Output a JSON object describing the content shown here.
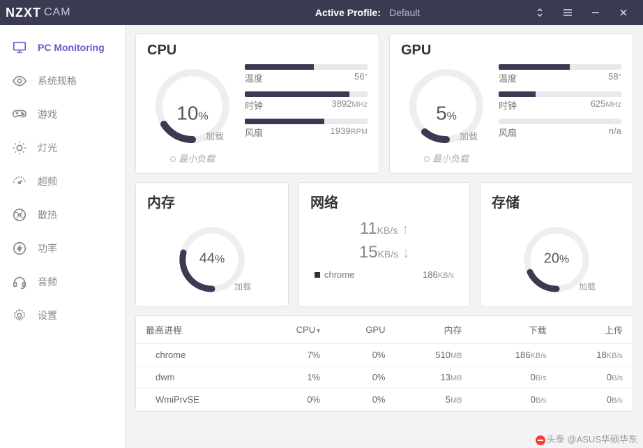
{
  "titlebar": {
    "brand": "NZXT",
    "brand_sub": "CAM",
    "profile_label": "Active Profile:",
    "profile_value": "Default"
  },
  "sidebar": [
    {
      "icon": "monitor",
      "label": "PC Monitoring",
      "active": true
    },
    {
      "icon": "eye",
      "label": "系统规格"
    },
    {
      "icon": "gamepad",
      "label": "游戏"
    },
    {
      "icon": "sun",
      "label": "灯光"
    },
    {
      "icon": "gauge",
      "label": "超频"
    },
    {
      "icon": "fan",
      "label": "散热"
    },
    {
      "icon": "power",
      "label": "功率"
    },
    {
      "icon": "headset",
      "label": "音频"
    },
    {
      "icon": "gear",
      "label": "设置"
    }
  ],
  "cpu": {
    "title": "CPU",
    "load_percent": 10,
    "load_label": "加载",
    "min_load_label": "最小负载",
    "stats": [
      {
        "label": "温度",
        "value": "56",
        "unit": "°",
        "fill": 56
      },
      {
        "label": "时钟",
        "value": "3892",
        "unit": "MHz",
        "fill": 85
      },
      {
        "label": "风扇",
        "value": "1939",
        "unit": "RPM",
        "fill": 65
      }
    ]
  },
  "gpu": {
    "title": "GPU",
    "load_percent": 5,
    "load_label": "加载",
    "min_load_label": "最小负载",
    "stats": [
      {
        "label": "温度",
        "value": "58",
        "unit": "°",
        "fill": 58
      },
      {
        "label": "时钟",
        "value": "625",
        "unit": "MHz",
        "fill": 30
      },
      {
        "label": "风扇",
        "value": "n/a",
        "unit": "",
        "fill": 0
      }
    ]
  },
  "memory": {
    "title": "内存",
    "percent": 44,
    "label": "加载"
  },
  "network": {
    "title": "网络",
    "up_value": "11",
    "up_unit": "KB/s",
    "down_value": "15",
    "down_unit": "KB/s",
    "top_proc": "chrome",
    "top_proc_rate": "186",
    "top_proc_unit": "KB/s"
  },
  "storage": {
    "title": "存储",
    "percent": 20,
    "label": "加载"
  },
  "table": {
    "title": "最高进程",
    "headers": [
      "CPU",
      "GPU",
      "内存",
      "下载",
      "上传"
    ],
    "rows": [
      {
        "name": "chrome",
        "cpu": "7%",
        "gpu": "0%",
        "mem": "510",
        "mem_unit": "MB",
        "down": "186",
        "down_unit": "KB/s",
        "up": "18",
        "up_unit": "KB/s"
      },
      {
        "name": "dwm",
        "cpu": "1%",
        "gpu": "0%",
        "mem": "13",
        "mem_unit": "MB",
        "down": "0",
        "down_unit": "B/s",
        "up": "0",
        "up_unit": "B/s"
      },
      {
        "name": "WmiPrvSE",
        "cpu": "0%",
        "gpu": "0%",
        "mem": "5",
        "mem_unit": "MB",
        "down": "0",
        "down_unit": "B/s",
        "up": "0",
        "up_unit": "B/s"
      }
    ]
  },
  "watermark": "头条 @ASUS华硕华东"
}
